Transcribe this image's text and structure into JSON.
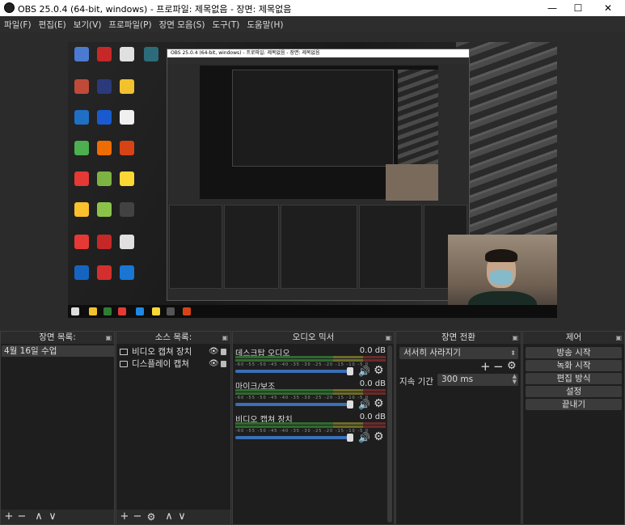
{
  "window": {
    "title": "OBS 25.0.4 (64-bit, windows) - 프로파일: 제목없음 - 장면: 제목없음",
    "min": "—",
    "max": "☐",
    "close": "✕"
  },
  "menu": [
    "파일(F)",
    "편집(E)",
    "보기(V)",
    "프로파일(P)",
    "장면 모음(S)",
    "도구(T)",
    "도움말(H)"
  ],
  "scenes": {
    "title": "장면 목록:",
    "items": [
      "4월 16일 수업"
    ],
    "footer": [
      "+",
      "−",
      "∧",
      "∨"
    ]
  },
  "sources": {
    "title": "소스 목록:",
    "items": [
      {
        "label": "비디오 캡쳐 장치",
        "icon": "camera-icon"
      },
      {
        "label": "디스플레이 캡쳐",
        "icon": "monitor-icon"
      }
    ],
    "footer": [
      "+",
      "−",
      "⚙",
      "∧",
      "∨"
    ]
  },
  "mixer": {
    "title": "오디오 믹서",
    "ticks": "-60 -55 -50 -45 -40 -35 -30 -25 -20 -15 -10 -5 0",
    "channels": [
      {
        "name": "데스크탑 오디오",
        "db": "0.0 dB",
        "level": 0.78
      },
      {
        "name": "마이크/보조",
        "db": "0.0 dB",
        "level": 0.78
      },
      {
        "name": "비디오 캡쳐 장치",
        "db": "0.0 dB",
        "level": 0.78
      }
    ]
  },
  "transitions": {
    "title": "장면 전환",
    "selected": "서서히 사라지기",
    "duration_label": "지속 기간",
    "duration_value": "300 ms",
    "plus": "+",
    "minus": "−",
    "gear": "⚙"
  },
  "controls": {
    "title": "제어",
    "buttons": [
      "방송 시작",
      "녹화 시작",
      "편집 방식",
      "설정",
      "끝내기"
    ]
  },
  "dock_float_icon": "▣",
  "nested_title": "OBS 25.0.4 (64-bit, windows) - 프로파일: 제목없음 - 장면: 제목없음"
}
